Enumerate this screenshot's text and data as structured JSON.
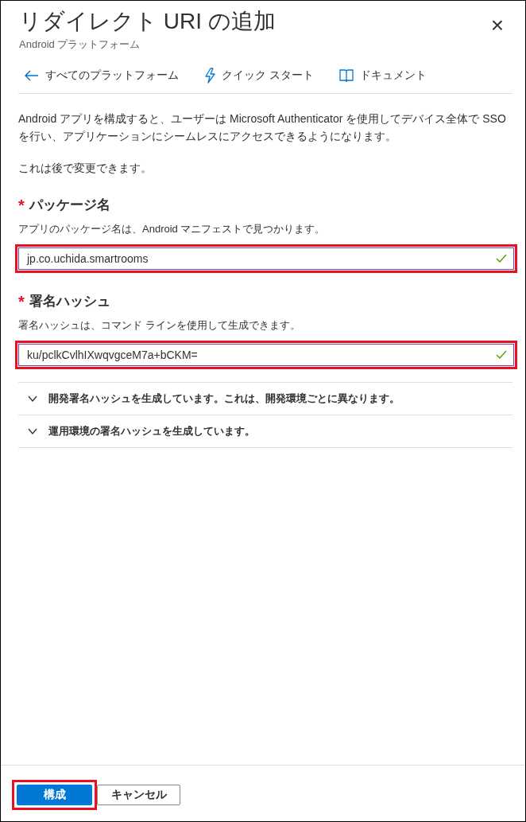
{
  "header": {
    "title": "リダイレクト URI の追加",
    "subtitle": "Android プラットフォーム",
    "close": "×"
  },
  "toolbar": [
    {
      "kind": "back",
      "label": "すべてのプラットフォーム"
    },
    {
      "kind": "quickstart",
      "label": "クイック スタート"
    },
    {
      "kind": "docs",
      "label": "ドキュメント"
    }
  ],
  "intro": [
    "Android アプリを構成すると、ユーザーは Microsoft Authenticator を使用してデバイス全体で SSO を行い、アプリケーションにシームレスにアクセスできるようになります。",
    "これは後で変更できます。"
  ],
  "fields": [
    {
      "label": "パッケージ名",
      "required_mark": "*",
      "description": "アプリのパッケージ名は、Android マニフェストで見つかります。",
      "value": "jp.co.uchida.smartrooms",
      "valid": true,
      "highlighted": true
    },
    {
      "label": "署名ハッシュ",
      "required_mark": "*",
      "description": "署名ハッシュは、コマンド ラインを使用して生成できます。",
      "value": "ku/pclkCvlhIXwqvgceM7a+bCKM=",
      "valid": true,
      "highlighted": true
    }
  ],
  "sections": [
    {
      "label": "開発署名ハッシュを生成しています。これは、開発環境ごとに異なります。",
      "expanded": false
    },
    {
      "label": "運用環境の署名ハッシュを生成しています。",
      "expanded": false
    }
  ],
  "buttons": [
    {
      "kind": "primary",
      "label": "構成",
      "highlighted": true
    },
    {
      "kind": "secondary",
      "label": "キャンセル",
      "highlighted": false
    }
  ]
}
